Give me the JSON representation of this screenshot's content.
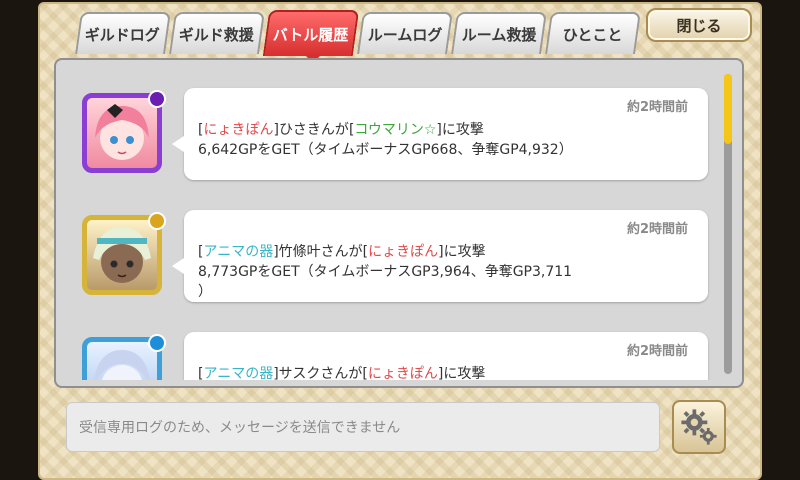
{
  "tabs": [
    {
      "label": "ギルドログ",
      "active": false
    },
    {
      "label": "ギルド救援",
      "active": false
    },
    {
      "label": "バトル履歴",
      "active": true
    },
    {
      "label": "ルームログ",
      "active": false
    },
    {
      "label": "ルーム救援",
      "active": false
    },
    {
      "label": "ひとこと",
      "active": false
    }
  ],
  "close_label": "閉じる",
  "entries": [
    {
      "time": "約2時間前",
      "avatar_color": "#8b3ed2",
      "line1": {
        "open1": "[",
        "name1": "にょきぽん",
        "close1": "]",
        "mid": "ひさきんが",
        "open2": "[",
        "name2": "コウマリン☆",
        "close2": "]",
        "end": "に攻撃"
      },
      "line2": "6,642GPをGET（タイムボーナスGP668、争奪GP4,932）"
    },
    {
      "time": "約2時間前",
      "avatar_color": "#d6b43a",
      "line1": {
        "open1": "[",
        "name1": "アニマの器",
        "close1": "]",
        "mid": "竹條叶さんが",
        "open2": "[",
        "name2": "にょきぽん",
        "close2": "]",
        "end": "に攻撃"
      },
      "line2": "8,773GPをGET（タイムボーナスGP3,964、争奪GP3,711",
      "line3": "）"
    },
    {
      "time": "約2時間前",
      "avatar_color": "#3ea0d6",
      "line1": {
        "open1": "[",
        "name1": "アニマの器",
        "close1": "]",
        "mid": "サスクさんが",
        "open2": "[",
        "name2": "にょきぽん",
        "close2": "]",
        "end": "に攻撃"
      }
    }
  ],
  "input_placeholder": "受信専用ログのため、メッセージを送信できません",
  "icons": {
    "settings": "gears-icon"
  },
  "colors": {
    "active_tab": "#d62f2f",
    "scroll_thumb": "#f5c518",
    "red_name": "#e04a4a",
    "green_name": "#3aa63a",
    "cyan_name": "#3ab5c8"
  }
}
